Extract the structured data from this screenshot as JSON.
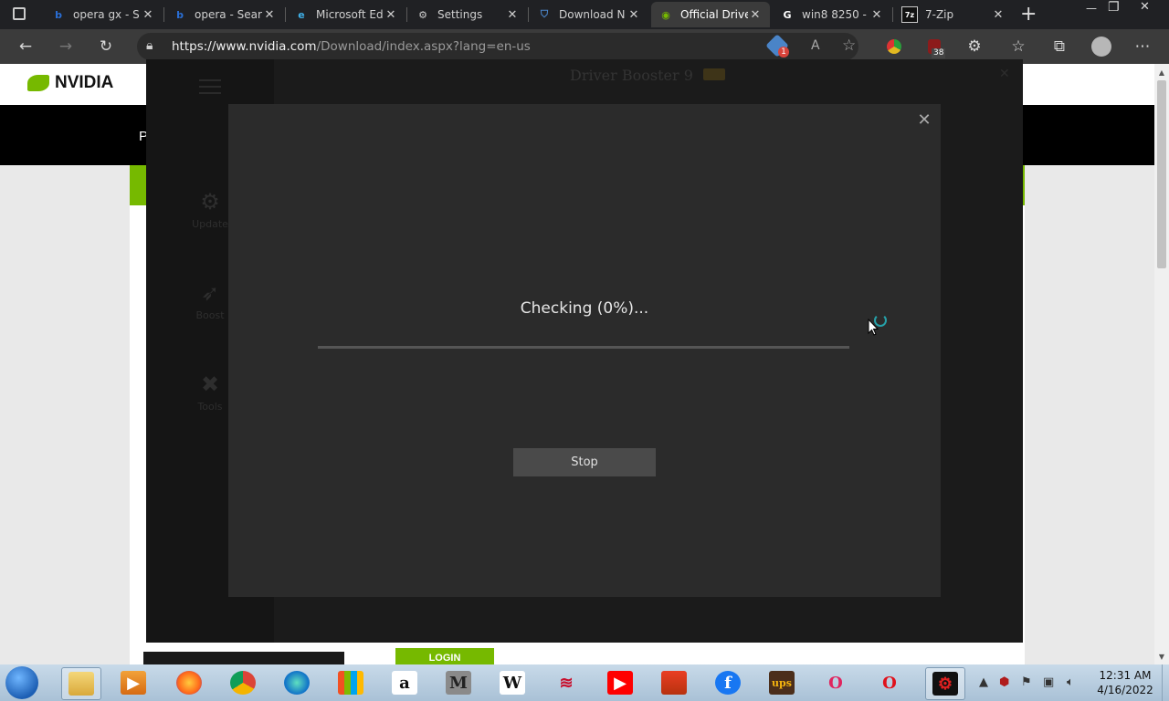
{
  "browser": {
    "tabs": [
      {
        "title": "opera gx - S",
        "icon": "bing-icon",
        "active": false
      },
      {
        "title": "opera - Sear",
        "icon": "bing-icon",
        "active": false
      },
      {
        "title": "Microsoft Ed",
        "icon": "edge-icon",
        "active": false
      },
      {
        "title": "Settings",
        "icon": "gear-icon",
        "active": false
      },
      {
        "title": "Download N",
        "icon": "shield-icon",
        "active": false
      },
      {
        "title": "Official Drive",
        "icon": "nvidia-icon",
        "active": true
      },
      {
        "title": "win8 8250 -",
        "icon": "google-icon",
        "active": false
      },
      {
        "title": "7-Zip",
        "icon": "7zip-icon",
        "active": false
      }
    ],
    "close_glyph": "✕",
    "new_tab_glyph": "+",
    "window_controls": {
      "minimize": "—",
      "restore": "❐",
      "close": "✕"
    },
    "url": {
      "host": "https://www.nvidia.com",
      "path": "/Download/index.aspx?lang=en-us"
    },
    "extension_badges": {
      "badge1": "1",
      "badge2": "38"
    }
  },
  "webpage": {
    "logo_text": "NVIDIA",
    "nav_letter": "P",
    "login_label": "LOGIN",
    "colors": {
      "brand_green": "#76b900"
    }
  },
  "driver_booster": {
    "title": "Driver Booster 9",
    "nav": [
      "Update",
      "Boost",
      "Tools"
    ]
  },
  "dialog": {
    "status_text": "Checking (0%)...",
    "progress": 0,
    "stop_label": "Stop",
    "colors": {
      "accent": "#2bc7d8",
      "background": "#2b2b2b"
    }
  },
  "taskbar": {
    "apps": [
      "file-explorer",
      "media-player",
      "firefox",
      "chrome",
      "edge",
      "store",
      "amazon",
      "m-app",
      "wikipedia",
      "bank-of-america",
      "youtube",
      "office",
      "facebook",
      "ups",
      "opera-gx",
      "opera",
      "driver-booster"
    ],
    "amazon_letter": "a",
    "m_letter": "M",
    "wiki_letter": "W",
    "ups_text": "ups",
    "clock_time": "12:31 AM",
    "clock_date": "4/16/2022"
  }
}
